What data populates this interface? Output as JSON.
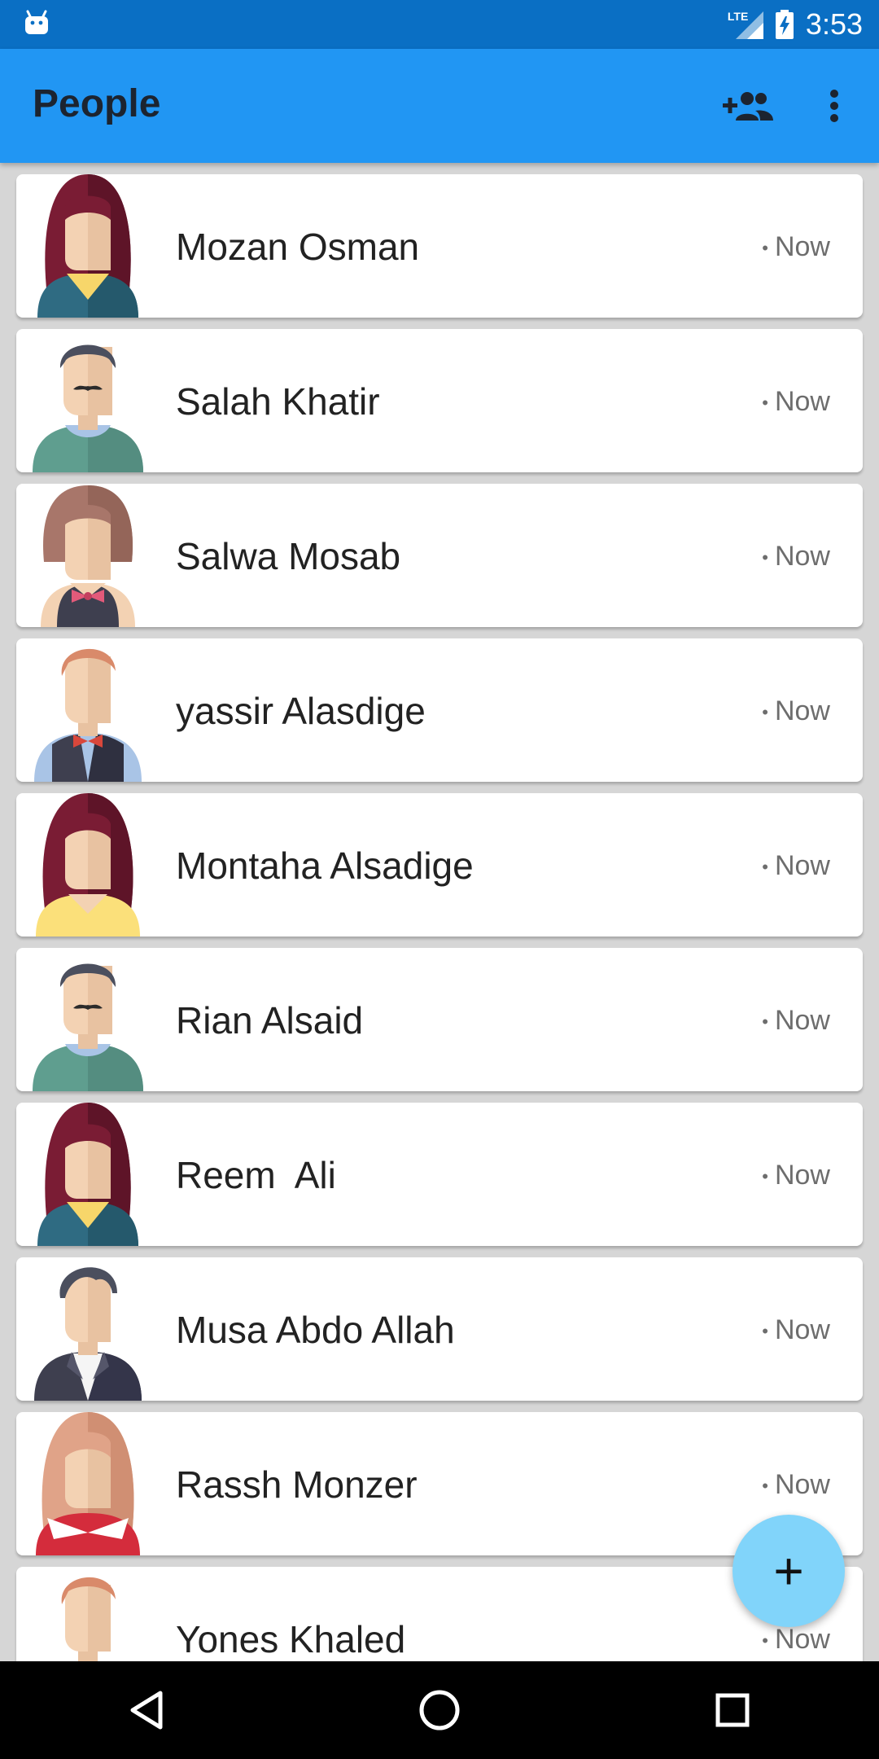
{
  "status_bar": {
    "time": "3:53",
    "network": "LTE"
  },
  "app_bar": {
    "title": "People",
    "add_people_icon": "add-people-icon",
    "more_icon": "more-vert-icon"
  },
  "people": [
    {
      "name": "Mozan Osman",
      "time": "Now",
      "avatar": "woman-maroon-hair-teal-top"
    },
    {
      "name": "Salah Khatir",
      "time": "Now",
      "avatar": "man-mustache-green-sweater"
    },
    {
      "name": "Salwa Mosab",
      "time": "Now",
      "avatar": "woman-brown-bob-bowtie"
    },
    {
      "name": "yassir Alasdige",
      "time": "Now",
      "avatar": "man-ginger-vest-bowtie"
    },
    {
      "name": "Montaha Alsadige",
      "time": "Now",
      "avatar": "woman-maroon-long-hair-yellow-top"
    },
    {
      "name": "Rian Alsaid",
      "time": "Now",
      "avatar": "man-mustache-green-sweater"
    },
    {
      "name": "Reem  Ali",
      "time": "Now",
      "avatar": "woman-maroon-hair-teal-top"
    },
    {
      "name": "Musa Abdo Allah",
      "time": "Now",
      "avatar": "man-dark-suit"
    },
    {
      "name": "Rassh Monzer",
      "time": "Now",
      "avatar": "woman-blonde-red-top"
    },
    {
      "name": "Yones Khaled",
      "time": "Now",
      "avatar": "man-ginger-vest-bowtie"
    }
  ],
  "fab": {
    "label": "+"
  },
  "colors": {
    "status_bar": "#0a6fc4",
    "app_bar": "#2196f3",
    "fab": "#81d4fa",
    "list_bg": "#d6d6d6"
  }
}
